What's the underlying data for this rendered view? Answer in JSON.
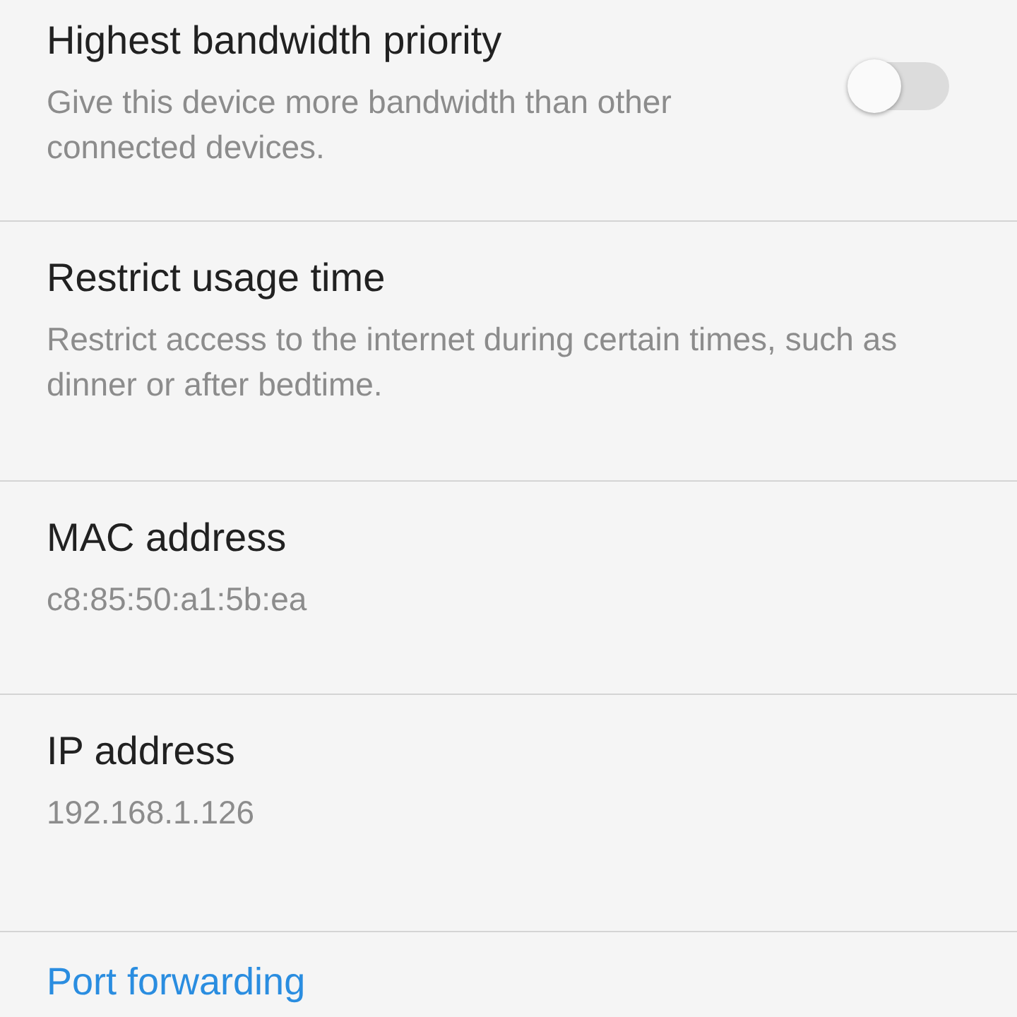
{
  "settings": [
    {
      "kind": "toggle",
      "title": "Highest bandwidth priority",
      "description": "Give this device more bandwidth than other connected devices.",
      "on": false
    },
    {
      "kind": "text",
      "title": "Restrict usage time",
      "description": "Restrict access to the internet during certain times, such as dinner or after bedtime."
    },
    {
      "kind": "text",
      "title": "MAC address",
      "description": "c8:85:50:a1:5b:ea"
    },
    {
      "kind": "text",
      "title": "IP address",
      "description": "192.168.1.126"
    },
    {
      "kind": "link",
      "title": "Port forwarding"
    }
  ]
}
